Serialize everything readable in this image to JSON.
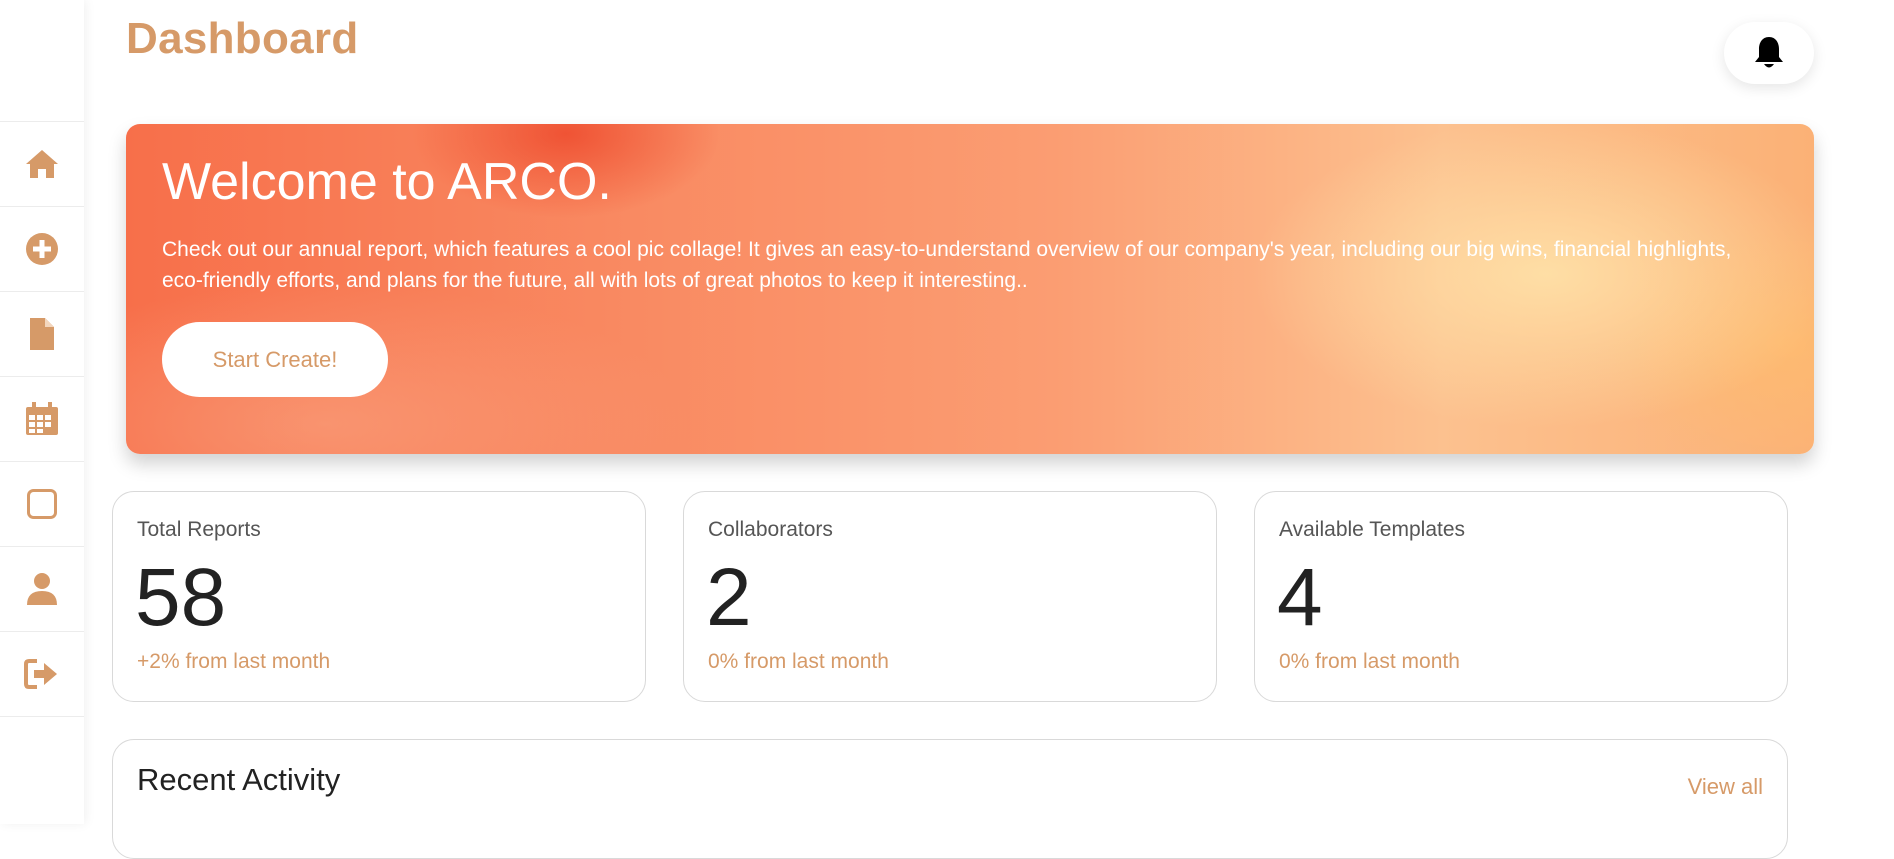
{
  "colors": {
    "accent": "#d69a68",
    "text_dark": "#222222",
    "text_muted": "#555555",
    "border": "#d9d9d9"
  },
  "sidebar": {
    "items": [
      {
        "icon": "home-icon"
      },
      {
        "icon": "plus-circle-icon"
      },
      {
        "icon": "file-icon"
      },
      {
        "icon": "calendar-icon"
      },
      {
        "icon": "square-icon"
      },
      {
        "icon": "user-icon"
      },
      {
        "icon": "sign-out-icon"
      }
    ]
  },
  "header": {
    "title": "Dashboard",
    "notification_icon": "bell-icon"
  },
  "banner": {
    "title": "Welcome to ARCO.",
    "text": "Check out our annual report, which features a cool pic collage! It gives an easy-to-understand overview of our company's year, including our big wins, financial highlights, eco-friendly efforts, and plans for the future, all with lots of great photos to keep it interesting..",
    "button_label": "Start Create!"
  },
  "stats": [
    {
      "label": "Total Reports",
      "value": "58",
      "delta": "+2% from last month"
    },
    {
      "label": "Collaborators",
      "value": "2",
      "delta": "0% from last month"
    },
    {
      "label": "Available Templates",
      "value": "4",
      "delta": "0% from last month"
    }
  ],
  "activity": {
    "title": "Recent Activity",
    "view_all_label": "View all"
  }
}
